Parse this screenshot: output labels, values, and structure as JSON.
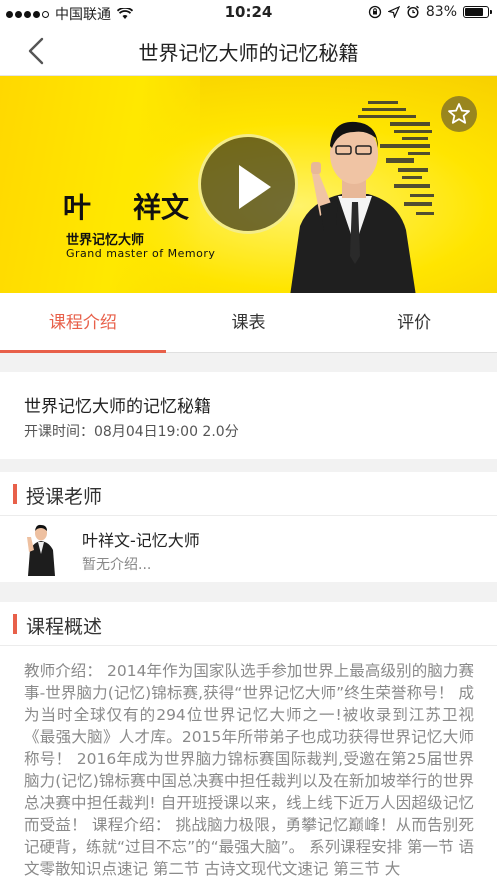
{
  "status_bar": {
    "carrier": "中国联通",
    "time": "10:24",
    "battery": "83%",
    "battery_level": 0.83
  },
  "nav": {
    "title": "世界记忆大师的记忆秘籍"
  },
  "banner": {
    "teacher_name_part1": "叶",
    "teacher_name_part2": "祥文",
    "title_cn": "世界记忆大师",
    "title_en": "Grand master of Memory",
    "accent_color": "#ffe500"
  },
  "tabs": [
    {
      "label": "课程介绍",
      "active": true
    },
    {
      "label": "课表",
      "active": false
    },
    {
      "label": "评价",
      "active": false
    }
  ],
  "course": {
    "name": "世界记忆大师的记忆秘籍",
    "time": "开课时间：08月04日19:00  2.0分"
  },
  "teacher_section": {
    "title": "授课老师",
    "name": "叶祥文-记忆大师",
    "intro": "暂无介绍..."
  },
  "overview_section": {
    "title": "课程概述",
    "text": "教师介绍： 2014年作为国家队选手参加世界上最高级别的脑力赛事-世界脑力(记忆)锦标赛,获得“世界记忆大师”终生荣誉称号！ 成为当时全球仅有的294位世界记忆大师之一!被收录到江苏卫视《最强大脑》人才库。2015年所带弟子也成功获得世界记忆大师称号！ 2016年成为世界脑力锦标赛国际裁判,受邀在第25届世界脑力(记忆)锦标赛中国总决赛中担任裁判以及在新加坡举行的世界总决赛中担任裁判! 自开班授课以来，线上线下近万人因超级记忆而受益！ 课程介绍： 挑战脑力极限，勇攀记忆巅峰！从而告别死记硬背，练就“过目不忘”的“最强大脑”。 系列课程安排 第一节 语文零散知识点速记 第二节  古诗文现代文速记 第三节  大"
  },
  "colors": {
    "accent": "#e8604a"
  }
}
